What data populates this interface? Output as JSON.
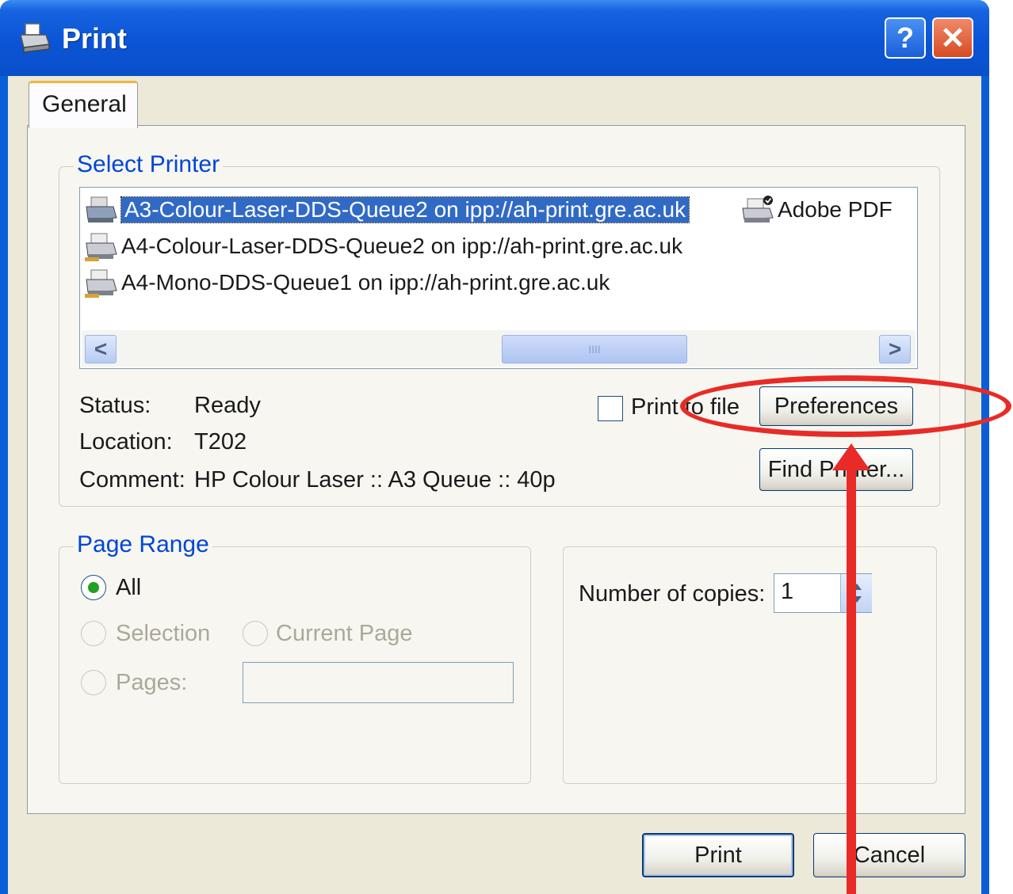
{
  "window": {
    "title": "Print",
    "help_label": "?",
    "close_label": "✕"
  },
  "tabs": [
    {
      "label": "General"
    }
  ],
  "select_printer": {
    "legend": "Select Printer",
    "printers": [
      {
        "label": "A3-Colour-Laser-DDS-Queue2 on ipp://ah-print.gre.ac.uk",
        "selected": true
      },
      {
        "label": "Adobe PDF",
        "selected": false
      },
      {
        "label": "A4-Colour-Laser-DDS-Queue2 on ipp://ah-print.gre.ac.uk",
        "selected": false
      },
      {
        "label": "A4-Mono-DDS-Queue1 on ipp://ah-print.gre.ac.uk",
        "selected": false
      }
    ],
    "scroll_left": "<",
    "scroll_right": ">",
    "scroll_grip": "IIII",
    "status_label": "Status:",
    "status_value": "Ready",
    "location_label": "Location:",
    "location_value": "T202",
    "comment_label": "Comment:",
    "comment_value": "HP Colour Laser :: A3 Queue :: 40p",
    "print_to_file_label": "Print to file",
    "print_to_file_checked": false,
    "preferences_label": "Preferences",
    "find_printer_label": "Find Printer..."
  },
  "page_range": {
    "legend": "Page Range",
    "all_label": "All",
    "selection_label": "Selection",
    "current_page_label": "Current Page",
    "pages_label": "Pages:",
    "pages_value": "",
    "selected_option": "All"
  },
  "copies": {
    "label": "Number of copies:",
    "value": "1"
  },
  "footer": {
    "print_label": "Print",
    "cancel_label": "Cancel"
  },
  "colors": {
    "titlebar": "#0a55d6",
    "selection": "#316ac5",
    "annotation": "#e82b26",
    "legend_text": "#0046d5"
  }
}
